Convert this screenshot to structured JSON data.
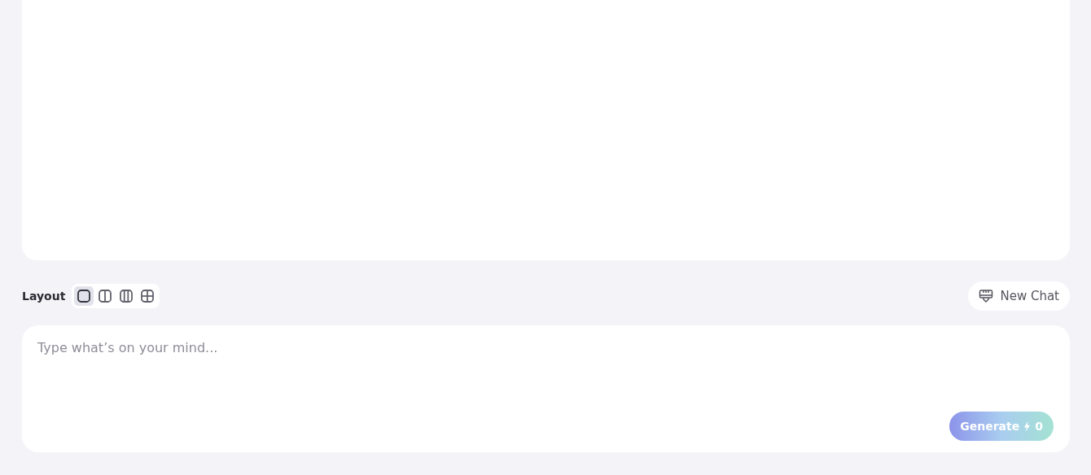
{
  "layout": {
    "label": "Layout",
    "options": [
      {
        "kind": "single",
        "selected": true
      },
      {
        "kind": "two-columns",
        "selected": false
      },
      {
        "kind": "three-columns",
        "selected": false
      },
      {
        "kind": "grid",
        "selected": false
      }
    ]
  },
  "new_chat": {
    "label": "New Chat"
  },
  "prompt": {
    "placeholder": "Type what’s on your mind..."
  },
  "generate": {
    "label": "Generate",
    "count": "0"
  }
}
